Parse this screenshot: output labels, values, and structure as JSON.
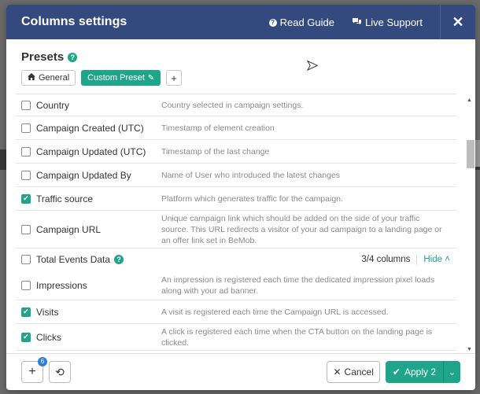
{
  "header": {
    "title": "Columns settings",
    "read_guide": "Read Guide",
    "live_support": "Live Support",
    "close": "✕"
  },
  "presets": {
    "title": "Presets",
    "help": "?",
    "general": "General",
    "custom": "Custom Preset",
    "add": "+"
  },
  "rows": [
    {
      "name": "Country",
      "desc": "Country selected in campaign settings.",
      "checked": false
    },
    {
      "name": "Campaign Created (UTC)",
      "desc": "Timestamp of element creation",
      "checked": false
    },
    {
      "name": "Campaign Updated (UTC)",
      "desc": "Timestamp of the last change",
      "checked": false
    },
    {
      "name": "Campaign Updated By",
      "desc": "Name of User who introduced the latest changes",
      "checked": false
    },
    {
      "name": "Traffic source",
      "desc": "Platform which generates traffic for the campaign.",
      "checked": true
    },
    {
      "name": "Campaign URL",
      "desc": "Unique campaign link which should be added on the side of your traffic source. This URL redirects a visitor of your ad campaign to a landing page or an offer link set in BeMob.",
      "checked": false
    }
  ],
  "section": {
    "name": "Total Events Data",
    "help": "?",
    "count": "3/4 columns",
    "hide": "Hide"
  },
  "rows2": [
    {
      "name": "Impressions",
      "desc": "An impression is registered each time the dedicated impression pixel loads along with your ad banner.",
      "checked": false
    },
    {
      "name": "Visits",
      "desc": "A visit is registered each time the Campaign URL is accessed.",
      "checked": true
    },
    {
      "name": "Clicks",
      "desc": "A click is registered each time when the CTA button on the landing page is clicked.",
      "checked": true
    }
  ],
  "footer": {
    "add": "+",
    "add_count": "6",
    "reset": "⟲",
    "cancel": "Cancel",
    "apply": "Apply 2"
  },
  "colors": {
    "header_bg": "#344a7e",
    "accent": "#1fa58a"
  }
}
